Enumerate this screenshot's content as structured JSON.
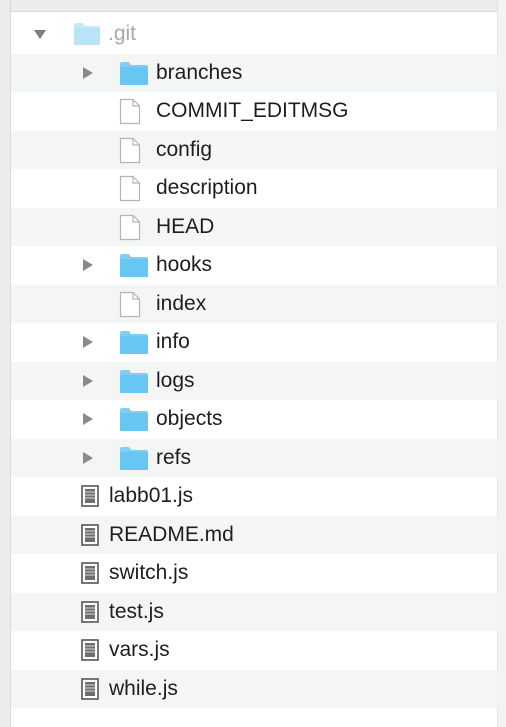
{
  "tree": {
    "root": {
      "label": ".git",
      "expanded": true,
      "icon": "folder-icon"
    },
    "children": [
      {
        "label": "branches",
        "icon": "folder-icon",
        "expandable": true
      },
      {
        "label": "COMMIT_EDITMSG",
        "icon": "file-icon",
        "expandable": false
      },
      {
        "label": "config",
        "icon": "file-icon",
        "expandable": false
      },
      {
        "label": "description",
        "icon": "file-icon",
        "expandable": false
      },
      {
        "label": "HEAD",
        "icon": "file-icon",
        "expandable": false
      },
      {
        "label": "hooks",
        "icon": "folder-icon",
        "expandable": true
      },
      {
        "label": "index",
        "icon": "file-icon",
        "expandable": false
      },
      {
        "label": "info",
        "icon": "folder-icon",
        "expandable": true
      },
      {
        "label": "logs",
        "icon": "folder-icon",
        "expandable": true
      },
      {
        "label": "objects",
        "icon": "folder-icon",
        "expandable": true
      },
      {
        "label": "refs",
        "icon": "folder-icon",
        "expandable": true
      }
    ],
    "files": [
      {
        "label": "labb01.js",
        "icon": "script-file-icon"
      },
      {
        "label": "README.md",
        "icon": "script-file-icon"
      },
      {
        "label": "switch.js",
        "icon": "script-file-icon"
      },
      {
        "label": "test.js",
        "icon": "script-file-icon"
      },
      {
        "label": "vars.js",
        "icon": "script-file-icon"
      },
      {
        "label": "while.js",
        "icon": "script-file-icon"
      }
    ]
  },
  "colors": {
    "folder": "#68c6f2",
    "folder_light": "#b9e3f7",
    "stripe": "#f4f5f5",
    "text": "#1e1e1e",
    "dim_text": "#a9a9a9"
  }
}
